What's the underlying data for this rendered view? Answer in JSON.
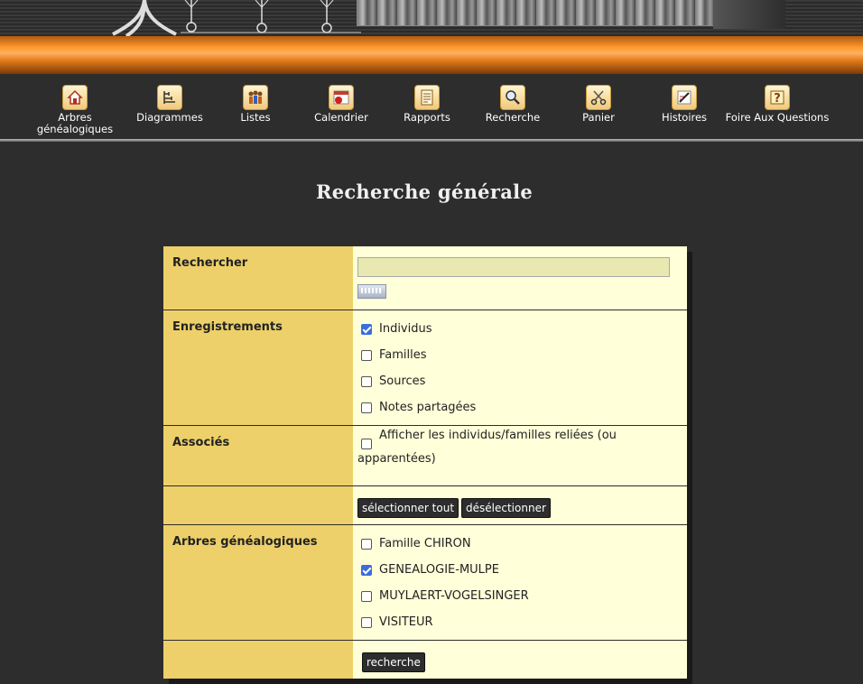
{
  "nav": {
    "items": [
      {
        "label": "Arbres\ngénéalogiques",
        "icon": "home-icon"
      },
      {
        "label": "Diagrammes",
        "icon": "chart-icon"
      },
      {
        "label": "Listes",
        "icon": "people-icon"
      },
      {
        "label": "Calendrier",
        "icon": "calendar-icon"
      },
      {
        "label": "Rapports",
        "icon": "report-icon"
      },
      {
        "label": "Recherche",
        "icon": "magnifier-icon"
      },
      {
        "label": "Panier",
        "icon": "scissors-icon"
      },
      {
        "label": "Histoires",
        "icon": "pen-icon"
      },
      {
        "label": "Foire Aux Questions",
        "icon": "question-icon"
      }
    ]
  },
  "page": {
    "title": "Recherche générale"
  },
  "form": {
    "search_label": "Rechercher",
    "search_value": "",
    "records_label": "Enregistrements",
    "records": [
      {
        "label": "Individus",
        "checked": true
      },
      {
        "label": "Familles",
        "checked": false
      },
      {
        "label": "Sources",
        "checked": false
      },
      {
        "label": "Notes partagées",
        "checked": false
      }
    ],
    "associates_label": "Associés",
    "associates_option": "Afficher les individus/familles reliées (ou apparentées)",
    "associates_checked": false,
    "select_all": "sélectionner tout",
    "deselect": "désélectionner",
    "trees_label": "Arbres généalogiques",
    "trees": [
      {
        "label": "Famille CHIRON",
        "checked": false
      },
      {
        "label": "GENEALOGIE-MULPE",
        "checked": true
      },
      {
        "label": "MUYLAERT-VOGELSINGER",
        "checked": false
      },
      {
        "label": "VISITEUR",
        "checked": false
      }
    ],
    "submit": "recherche"
  },
  "colors": {
    "label_bg": "#edd06a",
    "value_bg": "#ffffd9",
    "page_bg": "#2d2d2d",
    "accent": "#ff9a2e"
  }
}
